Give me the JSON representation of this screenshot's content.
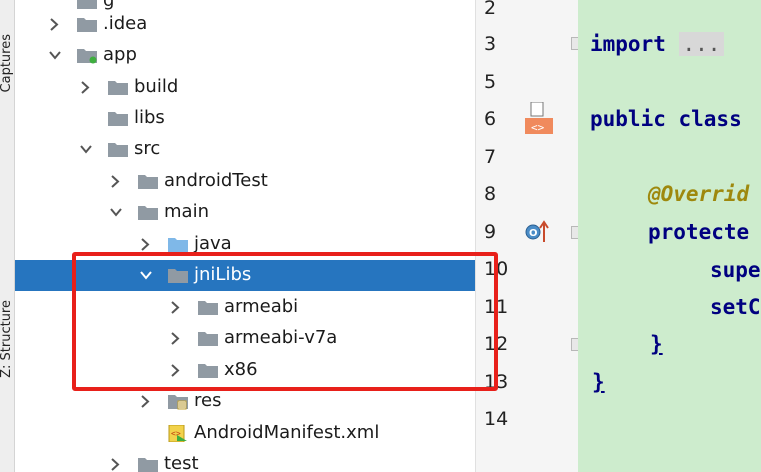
{
  "side_tabs": {
    "captures": "Captures",
    "structure": "Z: Structure"
  },
  "project_tree": {
    "items": [
      {
        "label": "g",
        "arrow": "none",
        "icon": "folder-icon",
        "state": "partial"
      },
      {
        "label": ".idea",
        "arrow": "right",
        "icon": "folder-icon"
      },
      {
        "label": "app",
        "arrow": "down",
        "icon": "module-folder-icon"
      },
      {
        "label": "build",
        "arrow": "right",
        "icon": "folder-icon"
      },
      {
        "label": "libs",
        "arrow": "none",
        "icon": "folder-icon"
      },
      {
        "label": "src",
        "arrow": "down",
        "icon": "folder-icon"
      },
      {
        "label": "androidTest",
        "arrow": "right",
        "icon": "folder-icon"
      },
      {
        "label": "main",
        "arrow": "down",
        "icon": "folder-icon"
      },
      {
        "label": "java",
        "arrow": "right",
        "icon": "source-folder-icon"
      },
      {
        "label": "jniLibs",
        "arrow": "down",
        "icon": "folder-icon",
        "selected": true
      },
      {
        "label": "armeabi",
        "arrow": "right",
        "icon": "folder-icon"
      },
      {
        "label": "armeabi-v7a",
        "arrow": "right",
        "icon": "folder-icon"
      },
      {
        "label": "x86",
        "arrow": "right",
        "icon": "folder-icon"
      },
      {
        "label": "res",
        "arrow": "right",
        "icon": "resource-folder-icon"
      },
      {
        "label": "AndroidManifest.xml",
        "arrow": "none",
        "icon": "manifest-file-icon"
      },
      {
        "label": "test",
        "arrow": "right",
        "icon": "folder-icon"
      }
    ]
  },
  "gutter": {
    "line_numbers": [
      "2",
      "3",
      "5",
      "6",
      "7",
      "8",
      "9",
      "10",
      "11",
      "12",
      "13",
      "14"
    ]
  },
  "code": {
    "import_kw": "import",
    "import_folded": "...",
    "class_decl": "public class",
    "annotation": "@Overrid",
    "protected_kw": "protecte",
    "super_kw": "supe",
    "setcontent": "setC",
    "close_brace_inner": "}",
    "close_brace_outer": "}"
  },
  "colors": {
    "selection": "#2675bf",
    "highlight_box": "#e8201a",
    "code_background": "#cdeccd",
    "keyword": "#000080",
    "annotation": "#9e880d"
  }
}
